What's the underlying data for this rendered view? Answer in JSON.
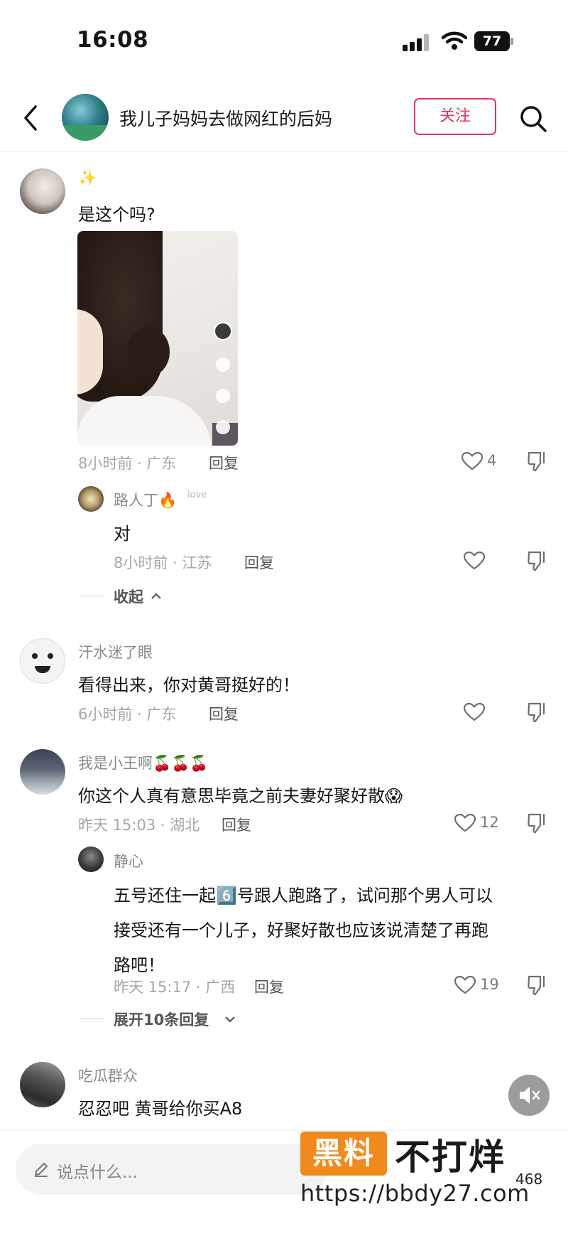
{
  "status_bar": {
    "time": "16:08",
    "battery": "77"
  },
  "header": {
    "title": "我儿子妈妈去做网红的后妈",
    "follow_label": "关注"
  },
  "comments": [
    {
      "username": "✨",
      "text": "是这个吗?",
      "time_location": "8小时前 · 广东",
      "reply_label": "回复",
      "likes": "4",
      "replies": [
        {
          "username": "路人丁🔥",
          "username_suffix": "love",
          "text": "对",
          "time_location": "8小时前 · 江苏",
          "reply_label": "回复",
          "likes": ""
        }
      ],
      "expand_label": "收起"
    },
    {
      "username": "汗水迷了眼",
      "text": "看得出来，你对黄哥挺好的！",
      "time_location": "6小时前 · 广东",
      "reply_label": "回复",
      "likes": ""
    },
    {
      "username": "我是小王啊🍒🍒🍒",
      "text": "你这个人真有意思毕竟之前夫妻好聚好散😱",
      "time_location": "昨天 15:03 · 湖北",
      "reply_label": "回复",
      "likes": "12",
      "replies": [
        {
          "username": "静心",
          "text_lines": [
            "五号还住一起6️⃣号跟人跑路了，试问那个男人可以",
            "接受还有一个儿子，好聚好散也应该说清楚了再跑",
            "路吧！"
          ],
          "time_location": "昨天 15:17 · 广西",
          "reply_label": "回复",
          "likes": "19"
        }
      ],
      "expand_label": "展开10条回复"
    },
    {
      "username": "吃瓜群众",
      "text": "忍忍吧  黄哥给你买A8",
      "time_location": "",
      "reply_label": ""
    }
  ],
  "input": {
    "placeholder": "说点什么..."
  },
  "bottom": {
    "count": "468"
  },
  "watermark": {
    "badge": "黑料",
    "text": "不打烊",
    "url": "https://bbdy27.com"
  },
  "icons": [
    "back-icon",
    "search-icon",
    "heart-icon",
    "dislike-icon",
    "chevron-up-icon",
    "chevron-down-icon",
    "pen-icon",
    "mute-icon",
    "signal-icon",
    "wifi-icon",
    "battery-icon"
  ],
  "colors": {
    "accent": "#d93a5d",
    "watermark_orange": "#f08a1c",
    "meta_gray": "#a6a6a6"
  }
}
